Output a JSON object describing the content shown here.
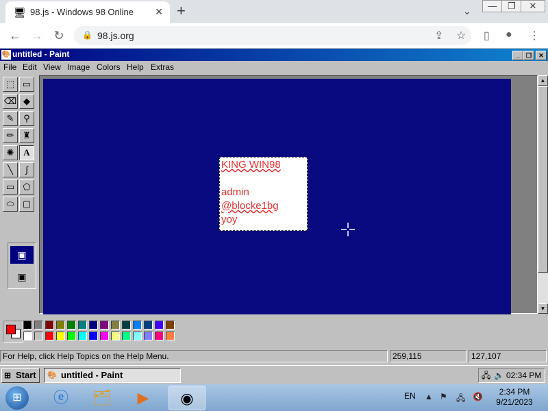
{
  "browser": {
    "tab_title": "98.js - Windows 98 Online",
    "tab_close": "✕",
    "new_tab": "+",
    "tab_dropdown": "⌄",
    "window_controls": [
      "—",
      "❐",
      "✕"
    ],
    "nav": {
      "back": "←",
      "forward": "→",
      "reload": "↻"
    },
    "url": "98.js.org",
    "lock": "🔒",
    "actions": {
      "share": "⇪",
      "bookmark": "☆",
      "sidepanel": "▯",
      "profile": "●",
      "menu": "⋮"
    }
  },
  "paint": {
    "window_title": "untitled - Paint",
    "caption_buttons": [
      "_",
      "❐",
      "✕"
    ],
    "menu": [
      "File",
      "Edit",
      "View",
      "Image",
      "Colors",
      "Help",
      "Extras"
    ],
    "tools": [
      {
        "name": "free-form-select-tool",
        "glyph": "⬚"
      },
      {
        "name": "select-tool",
        "glyph": "▭"
      },
      {
        "name": "eraser-tool",
        "glyph": "⌫"
      },
      {
        "name": "fill-tool",
        "glyph": "◆"
      },
      {
        "name": "pick-color-tool",
        "glyph": "✎"
      },
      {
        "name": "magnifier-tool",
        "glyph": "⚲"
      },
      {
        "name": "pencil-tool",
        "glyph": "✏"
      },
      {
        "name": "brush-tool",
        "glyph": "♜"
      },
      {
        "name": "airbrush-tool",
        "glyph": "✺"
      },
      {
        "name": "text-tool",
        "glyph": "A"
      },
      {
        "name": "line-tool",
        "glyph": "╲"
      },
      {
        "name": "curve-tool",
        "glyph": "∫"
      },
      {
        "name": "rectangle-tool",
        "glyph": "▭"
      },
      {
        "name": "polygon-tool",
        "glyph": "⬠"
      },
      {
        "name": "ellipse-tool",
        "glyph": "⬭"
      },
      {
        "name": "rounded-rectangle-tool",
        "glyph": "▢"
      }
    ],
    "selected_tool": "text-tool",
    "canvas_color": "#0a0a80",
    "text_lines": [
      "KING WIN98",
      "",
      "admin",
      "@blocke1bg",
      "yoy"
    ],
    "text_color": "#e03030",
    "palette_top": [
      "#000000",
      "#808080",
      "#800000",
      "#808000",
      "#008000",
      "#008080",
      "#000080",
      "#800080",
      "#808040",
      "#004040",
      "#0080ff",
      "#004080",
      "#4000ff",
      "#804000"
    ],
    "palette_bottom": [
      "#ffffff",
      "#c0c0c0",
      "#ff0000",
      "#ffff00",
      "#00ff00",
      "#00ffff",
      "#0000ff",
      "#ff00ff",
      "#ffff80",
      "#00ff80",
      "#80ffff",
      "#8080ff",
      "#ff0080",
      "#ff8040"
    ],
    "foreground_color": "#ff0000",
    "background_color": "#ffffff",
    "status_help": "For Help, click Help Topics on the Help Menu.",
    "status_pos": "259,115",
    "status_size": "127,107"
  },
  "taskbar98": {
    "start_label": "Start",
    "task_label": "untitled - Paint",
    "clock": "02:34 PM"
  },
  "win7": {
    "lang": "EN",
    "time": "2:34 PM",
    "date": "9/21/2023",
    "pins": [
      "internet-explorer-icon",
      "file-explorer-icon",
      "media-player-icon",
      "chrome-icon"
    ]
  }
}
